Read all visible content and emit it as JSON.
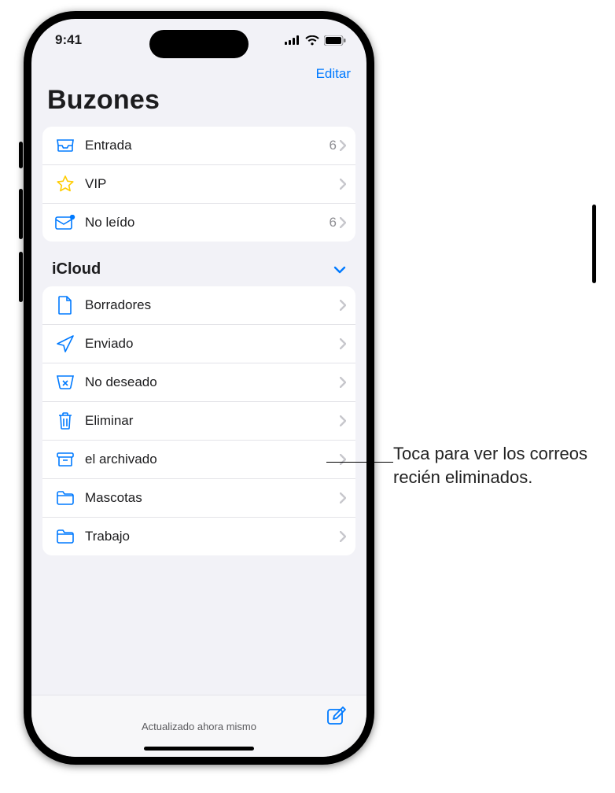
{
  "status": {
    "time": "9:41"
  },
  "nav": {
    "edit": "Editar"
  },
  "title": "Buzones",
  "topBox": [
    {
      "icon": "inbox",
      "label": "Entrada",
      "count": "6"
    },
    {
      "icon": "star",
      "label": "VIP",
      "count": ""
    },
    {
      "icon": "unread",
      "label": "No leído",
      "count": "6"
    }
  ],
  "section": {
    "title": "iCloud"
  },
  "icloud": [
    {
      "icon": "draft",
      "label": "Borradores"
    },
    {
      "icon": "sent",
      "label": "Enviado"
    },
    {
      "icon": "junk",
      "label": "No deseado"
    },
    {
      "icon": "trash",
      "label": "Eliminar"
    },
    {
      "icon": "archive",
      "label": "el archivado"
    },
    {
      "icon": "folder",
      "label": "Mascotas"
    },
    {
      "icon": "folder",
      "label": "Trabajo"
    }
  ],
  "bottom": {
    "status": "Actualizado ahora mismo"
  },
  "callout": "Toca para ver los correos recién eliminados."
}
